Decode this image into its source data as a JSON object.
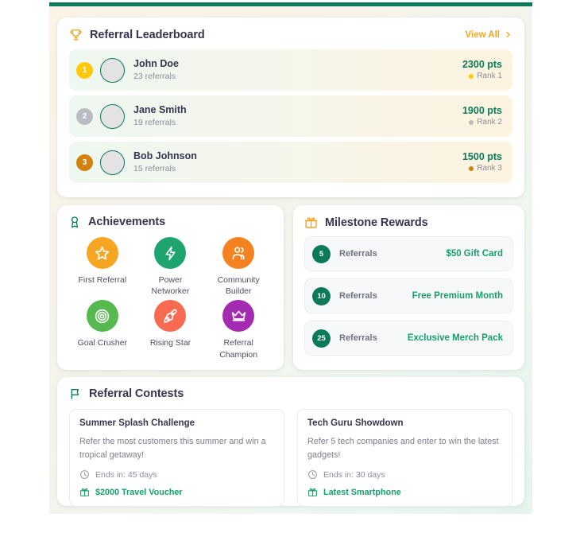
{
  "theme": {
    "accent_green": "#0b7a5a",
    "accent_green_light": "#17a06a",
    "accent_amber": "#f5a623",
    "top_bar": "#0b7a5a",
    "title_color": "#35364f"
  },
  "leaderboard": {
    "icon": "trophy-icon",
    "title": "Referral Leaderboard",
    "view_all_label": "View All",
    "chevron": "›",
    "rows": [
      {
        "rank": "1",
        "name": "John Doe",
        "referrals": "23 referrals",
        "points": "2300 pts",
        "rank_label": "Rank 1",
        "badge_color": "#FFC907",
        "dot_color": "#FFC907"
      },
      {
        "rank": "2",
        "name": "Jane Smith",
        "referrals": "19 referrals",
        "points": "1900 pts",
        "rank_label": "Rank 2",
        "badge_color": "#B9BCC2",
        "dot_color": "#B9BCC2"
      },
      {
        "rank": "3",
        "name": "Bob Johnson",
        "referrals": "15 referrals",
        "points": "1500 pts",
        "rank_label": "Rank 3",
        "badge_color": "#D4820F",
        "dot_color": "#D4820F"
      }
    ]
  },
  "achievements": {
    "icon": "award-ribbon-icon",
    "title": "Achievements",
    "items": [
      {
        "label": "First Referral",
        "icon": "star-icon",
        "color": "#F6A623"
      },
      {
        "label": "Power Networker",
        "icon": "lightning-bolt-icon",
        "color": "#1DA46F"
      },
      {
        "label": "Community Builder",
        "icon": "users-icon",
        "color": "#F58220"
      },
      {
        "label": "Goal Crusher",
        "icon": "target-icon",
        "color": "#56B94F"
      },
      {
        "label": "Rising Star",
        "icon": "rocket-icon",
        "color": "#F96A52"
      },
      {
        "label": "Referral Champion",
        "icon": "crown-icon",
        "color": "#A32BB0"
      }
    ]
  },
  "milestones": {
    "icon": "gift-icon",
    "title": "Milestone Rewards",
    "rows": [
      {
        "count": "5",
        "label": "Referrals",
        "reward": "$50 Gift Card"
      },
      {
        "count": "10",
        "label": "Referrals",
        "reward": "Free Premium Month"
      },
      {
        "count": "25",
        "label": "Referrals",
        "reward": "Exclusive Merch Pack"
      }
    ]
  },
  "contests": {
    "icon": "flag-icon",
    "title": "Referral Contests",
    "cards": [
      {
        "title": "Summer Splash Challenge",
        "description": "Refer the most customers this summer and win a tropical getaway!",
        "ends_label": "Ends in: 45 days",
        "prize": "$2000 Travel Voucher"
      },
      {
        "title": "Tech Guru Showdown",
        "description": "Refer 5 tech companies and enter to win the latest gadgets!",
        "ends_label": "Ends in: 30 days",
        "prize": "Latest Smartphone"
      }
    ]
  }
}
